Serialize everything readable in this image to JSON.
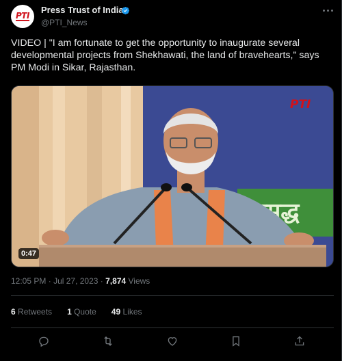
{
  "account": {
    "name": "Press Trust of India",
    "handle": "@PTI_News",
    "avatar_text": "PTI",
    "verified_icon": "verified-badge-icon"
  },
  "tweet": {
    "text": "VIDEO | \"I am fortunate to get the opportunity to inaugurate several developmental projects from Shekhawati, the land of bravehearts,\" says PM Modi in Sikar, Rajasthan.",
    "media": {
      "duration": "0:47",
      "watermark": "PTI",
      "banner_text": "समृद्ध"
    },
    "time": "12:05 PM",
    "date": "Jul 27, 2023",
    "views_count": "7,874",
    "views_label": "Views",
    "separator": "·"
  },
  "stats": {
    "retweets_count": "6",
    "retweets_label": "Retweets",
    "quotes_count": "1",
    "quotes_label": "Quote",
    "likes_count": "49",
    "likes_label": "Likes"
  },
  "colors": {
    "background": "#000000",
    "text": "#e7e9ea",
    "muted": "#71767b",
    "verified": "#1d9bf0",
    "brand_red": "#d0121b"
  },
  "icons": [
    "more-icon",
    "reply-icon",
    "retweet-icon",
    "like-icon",
    "bookmark-icon",
    "share-icon"
  ]
}
